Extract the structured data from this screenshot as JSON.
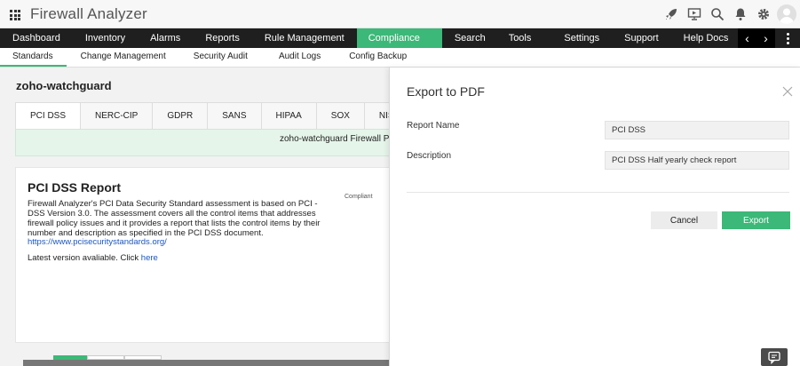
{
  "app": {
    "title": "Firewall Analyzer"
  },
  "top_icons": [
    "rocket-icon",
    "presentation-icon",
    "search-icon",
    "bell-icon",
    "gear-icon",
    "user-avatar-icon"
  ],
  "main_nav": {
    "items": [
      "Dashboard",
      "Inventory",
      "Alarms",
      "Reports",
      "Rule Management",
      "Compliance",
      "Search",
      "Tools",
      "Settings",
      "Support",
      "Help Docs"
    ],
    "active": "Compliance",
    "prev_arrow": "‹",
    "next_arrow": "›"
  },
  "sub_nav": {
    "items": [
      "Standards",
      "Change Management",
      "Security Audit",
      "Audit Logs",
      "Config Backup"
    ],
    "active": "Standards"
  },
  "content": {
    "device_name": "zoho-watchguard",
    "standard_tabs": [
      "PCI DSS",
      "NERC-CIP",
      "GDPR",
      "SANS",
      "HIPAA",
      "SOX",
      "NIST"
    ],
    "active_tab": "PCI DSS",
    "banner_text": "zoho-watchguard Firewall PCI D",
    "report": {
      "title": "PCI DSS Report",
      "description": "Firewall Analyzer's PCI Data Security Standard assessment is based on PCI - DSS Version 3.0. The assessment covers all the control items that addresses firewall policy issues and it provides a report that lists the control items by their number and description as specified in the PCI DSS document.",
      "link": "https://www.pcisecuritystandards.org/",
      "latest_prefix": "Latest version avaliable. Click ",
      "latest_link": "here"
    },
    "chart_label": "Compliant"
  },
  "modal": {
    "title": "Export to PDF",
    "report_name_label": "Report Name",
    "report_name_value": "PCI DSS",
    "description_label": "Description",
    "description_value": "PCI DSS Half yearly check report",
    "cancel_label": "Cancel",
    "export_label": "Export"
  },
  "colors": {
    "accent_green": "#3cb878",
    "nav_dark": "#1f1f1f",
    "link_blue": "#1a56c4"
  }
}
